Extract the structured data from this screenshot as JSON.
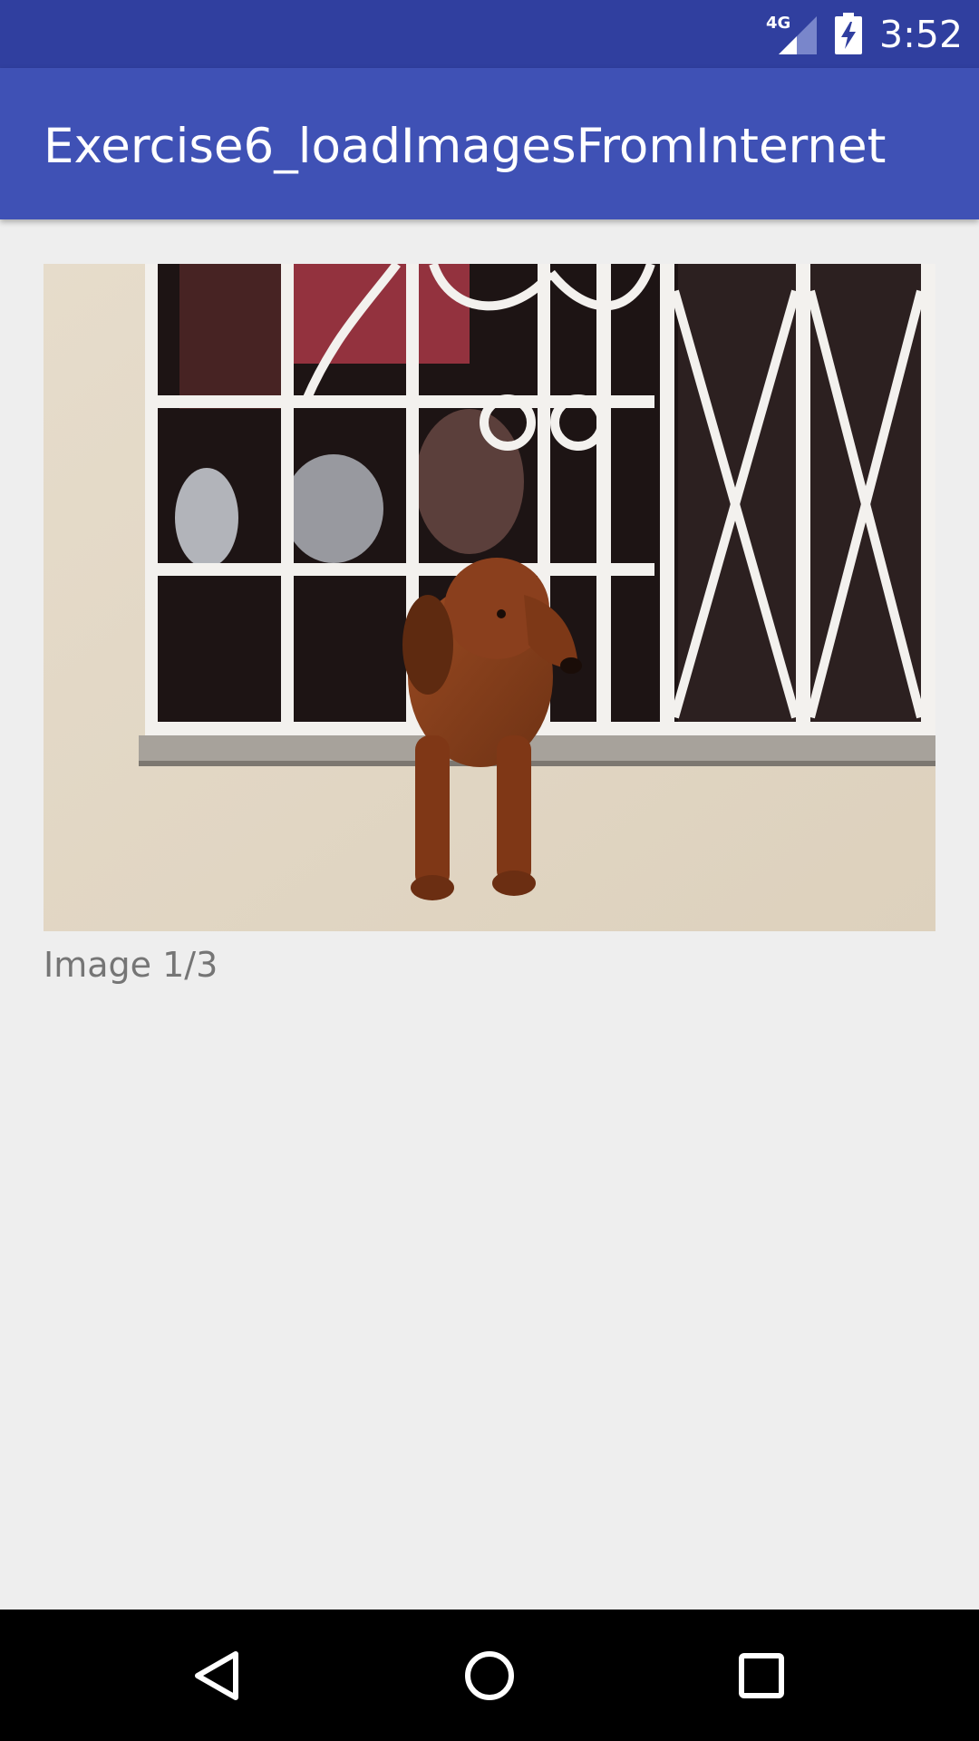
{
  "status_bar": {
    "network": "4G",
    "time": "3:52",
    "icons": [
      "signal-4g-icon",
      "battery-charging-icon"
    ]
  },
  "app_bar": {
    "title": "Exercise6_loadImagesFromInternet",
    "color": "#3f51b5",
    "status_color": "#303f9f"
  },
  "content": {
    "image": {
      "description_icon": "photo-dachshund-in-window"
    },
    "caption": "Image 1/3"
  },
  "nav_bar": {
    "icons": [
      "back-icon",
      "home-icon",
      "recents-icon"
    ]
  }
}
